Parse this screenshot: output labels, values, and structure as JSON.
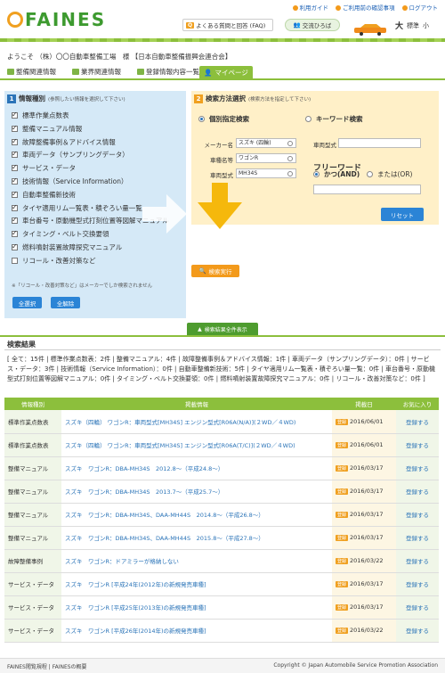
{
  "header": {
    "logo_text": "FAINES",
    "top_links": [
      "利用ガイド",
      "ご利用前の確認事項",
      "ログアウト"
    ],
    "faq_badge": "Q",
    "faq_label": "よくある質問と回答 (FAQ)",
    "koryu_label": "交流ひろば",
    "font_size": {
      "large": "大",
      "standard": "標準",
      "small": "小"
    }
  },
  "welcome": "ようこそ （株）〇〇自動車整備工場　様 【日本自動車整備振興会連合会】",
  "nav": {
    "tabs": [
      "整備関連情報",
      "業界関連情報",
      "登録情報内容一覧",
      "マイページ"
    ]
  },
  "info_type": {
    "num": "1",
    "title": "情報種別",
    "note": "(参照したい情報を選択して下さい)",
    "items": [
      {
        "label": "標準作業点数表",
        "checked": true
      },
      {
        "label": "整備マニュアル情報",
        "checked": true
      },
      {
        "label": "故障整備事例＆アドバイス情報",
        "checked": true
      },
      {
        "label": "車両データ（サンプリングデータ）",
        "checked": true
      },
      {
        "label": "サービス・データ",
        "checked": true
      },
      {
        "label": "技術情報（Service Information）",
        "checked": true
      },
      {
        "label": "自動車整備新技術",
        "checked": true
      },
      {
        "label": "タイヤ適用リム一覧表・積ぞろい量一覧",
        "checked": true
      },
      {
        "label": "車台番号・原動機型式打刻位置等図解マニュアル",
        "checked": true
      },
      {
        "label": "タイミング・ベルト交換要領",
        "checked": true
      },
      {
        "label": "燃料噴射装置故障探究マニュアル",
        "checked": true
      },
      {
        "label": "リコール・改善対策など",
        "checked": false
      }
    ],
    "recall_note": "※「リコール・改善対策など」はメーカーでしか検索されません",
    "select_all": "全選択",
    "clear_all": "全解除"
  },
  "search_method": {
    "num": "2",
    "title": "検索方法選択",
    "note": "(検索方法を指定して下さい)",
    "individual_label": "個別指定検索",
    "keyword_label": "キーワード検索",
    "fields": [
      {
        "label": "メーカー名",
        "value": "スズキ (四輪)"
      },
      {
        "label": "車種名等",
        "value": "ワゴンR"
      },
      {
        "label": "車両型式",
        "value": "MH34S"
      }
    ],
    "engine_label": "車両型式",
    "engine_value": "",
    "freeword_label": "フリーワード",
    "and_label": "かつ(AND)",
    "or_label": "または(OR)",
    "freeword_value": "",
    "reset_label": "リセット"
  },
  "search_button": "検索実行",
  "show_all_label": "検索結果全件表示",
  "results": {
    "heading": "検索結果",
    "summary": "[ 全て：15件 | 標準作業点数表：2件 | 整備マニュアル：4件 | 故障整備事例＆アドバイス情報：1件 | 車両データ（サンプリングデータ）：0件 | サービス・データ：3件 | 技術情報（Service Information）：0件 | 自動車整備新技術：5件 | タイヤ適用リム一覧表・積ぞろい量一覧：0件 | 車台番号・原動機型式打刻位置等図解マニュアル：0件 | タイミング・ベルト交換要領：0件 | 燃料噴射装置故障探究マニュアル：0件 | リコール・改善対策など：0件 ]",
    "columns": [
      "情報種別",
      "掲載情報",
      "掲載日",
      "お気に入り"
    ],
    "badge": "登録",
    "fav_label": "登録する",
    "rows": [
      {
        "cat": "標準作業点数表",
        "title": "スズキ（四輪） ワゴンR：車両型式[MH34S] エンジン型式[R06A(N/A)](２WD／４WD)",
        "date": "2016/06/01"
      },
      {
        "cat": "標準作業点数表",
        "title": "スズキ（四輪） ワゴンR：車両型式[MH34S] エンジン型式[R06A(T/C)](２WD／４WD)",
        "date": "2016/06/01"
      },
      {
        "cat": "整備マニュアル",
        "title": "スズキ　ワゴンR：DBA-MH34S　2012.8～（平成24.8～）",
        "date": "2016/03/17"
      },
      {
        "cat": "整備マニュアル",
        "title": "スズキ　ワゴンR：DBA-MH34S　2013.7～（平成25.7～）",
        "date": "2016/03/17"
      },
      {
        "cat": "整備マニュアル",
        "title": "スズキ　ワゴンR：DBA-MH34S、DAA-MH44S　2014.8～（平成26.8～）",
        "date": "2016/03/17"
      },
      {
        "cat": "整備マニュアル",
        "title": "スズキ　ワゴンR：DBA-MH34S、DAA-MH44S　2015.8～（平成27.8～）",
        "date": "2016/03/17"
      },
      {
        "cat": "故障整備事例",
        "title": "スズキ　ワゴンR：ドアミラーが格納しない",
        "date": "2016/03/22"
      },
      {
        "cat": "サービス・データ",
        "title": "スズキ　ワゴンR [平成24年(2012年)の新規発売車種]",
        "date": "2016/03/17"
      },
      {
        "cat": "サービス・データ",
        "title": "スズキ　ワゴンR [平成25年(2013年)の新規発売車種]",
        "date": "2016/03/17"
      },
      {
        "cat": "サービス・データ",
        "title": "スズキ　ワゴンR [平成26年(2014年)の新規発売車種]",
        "date": "2016/03/22"
      }
    ]
  },
  "footer": {
    "left": "FAINES閲覧規程 | FAINESの概要",
    "right": "Copyright © Japan Automobile Service Promotion Association"
  },
  "colors": {
    "green": "#8cbf3c",
    "blue": "#2b84d6",
    "orange": "#f39a1b"
  }
}
